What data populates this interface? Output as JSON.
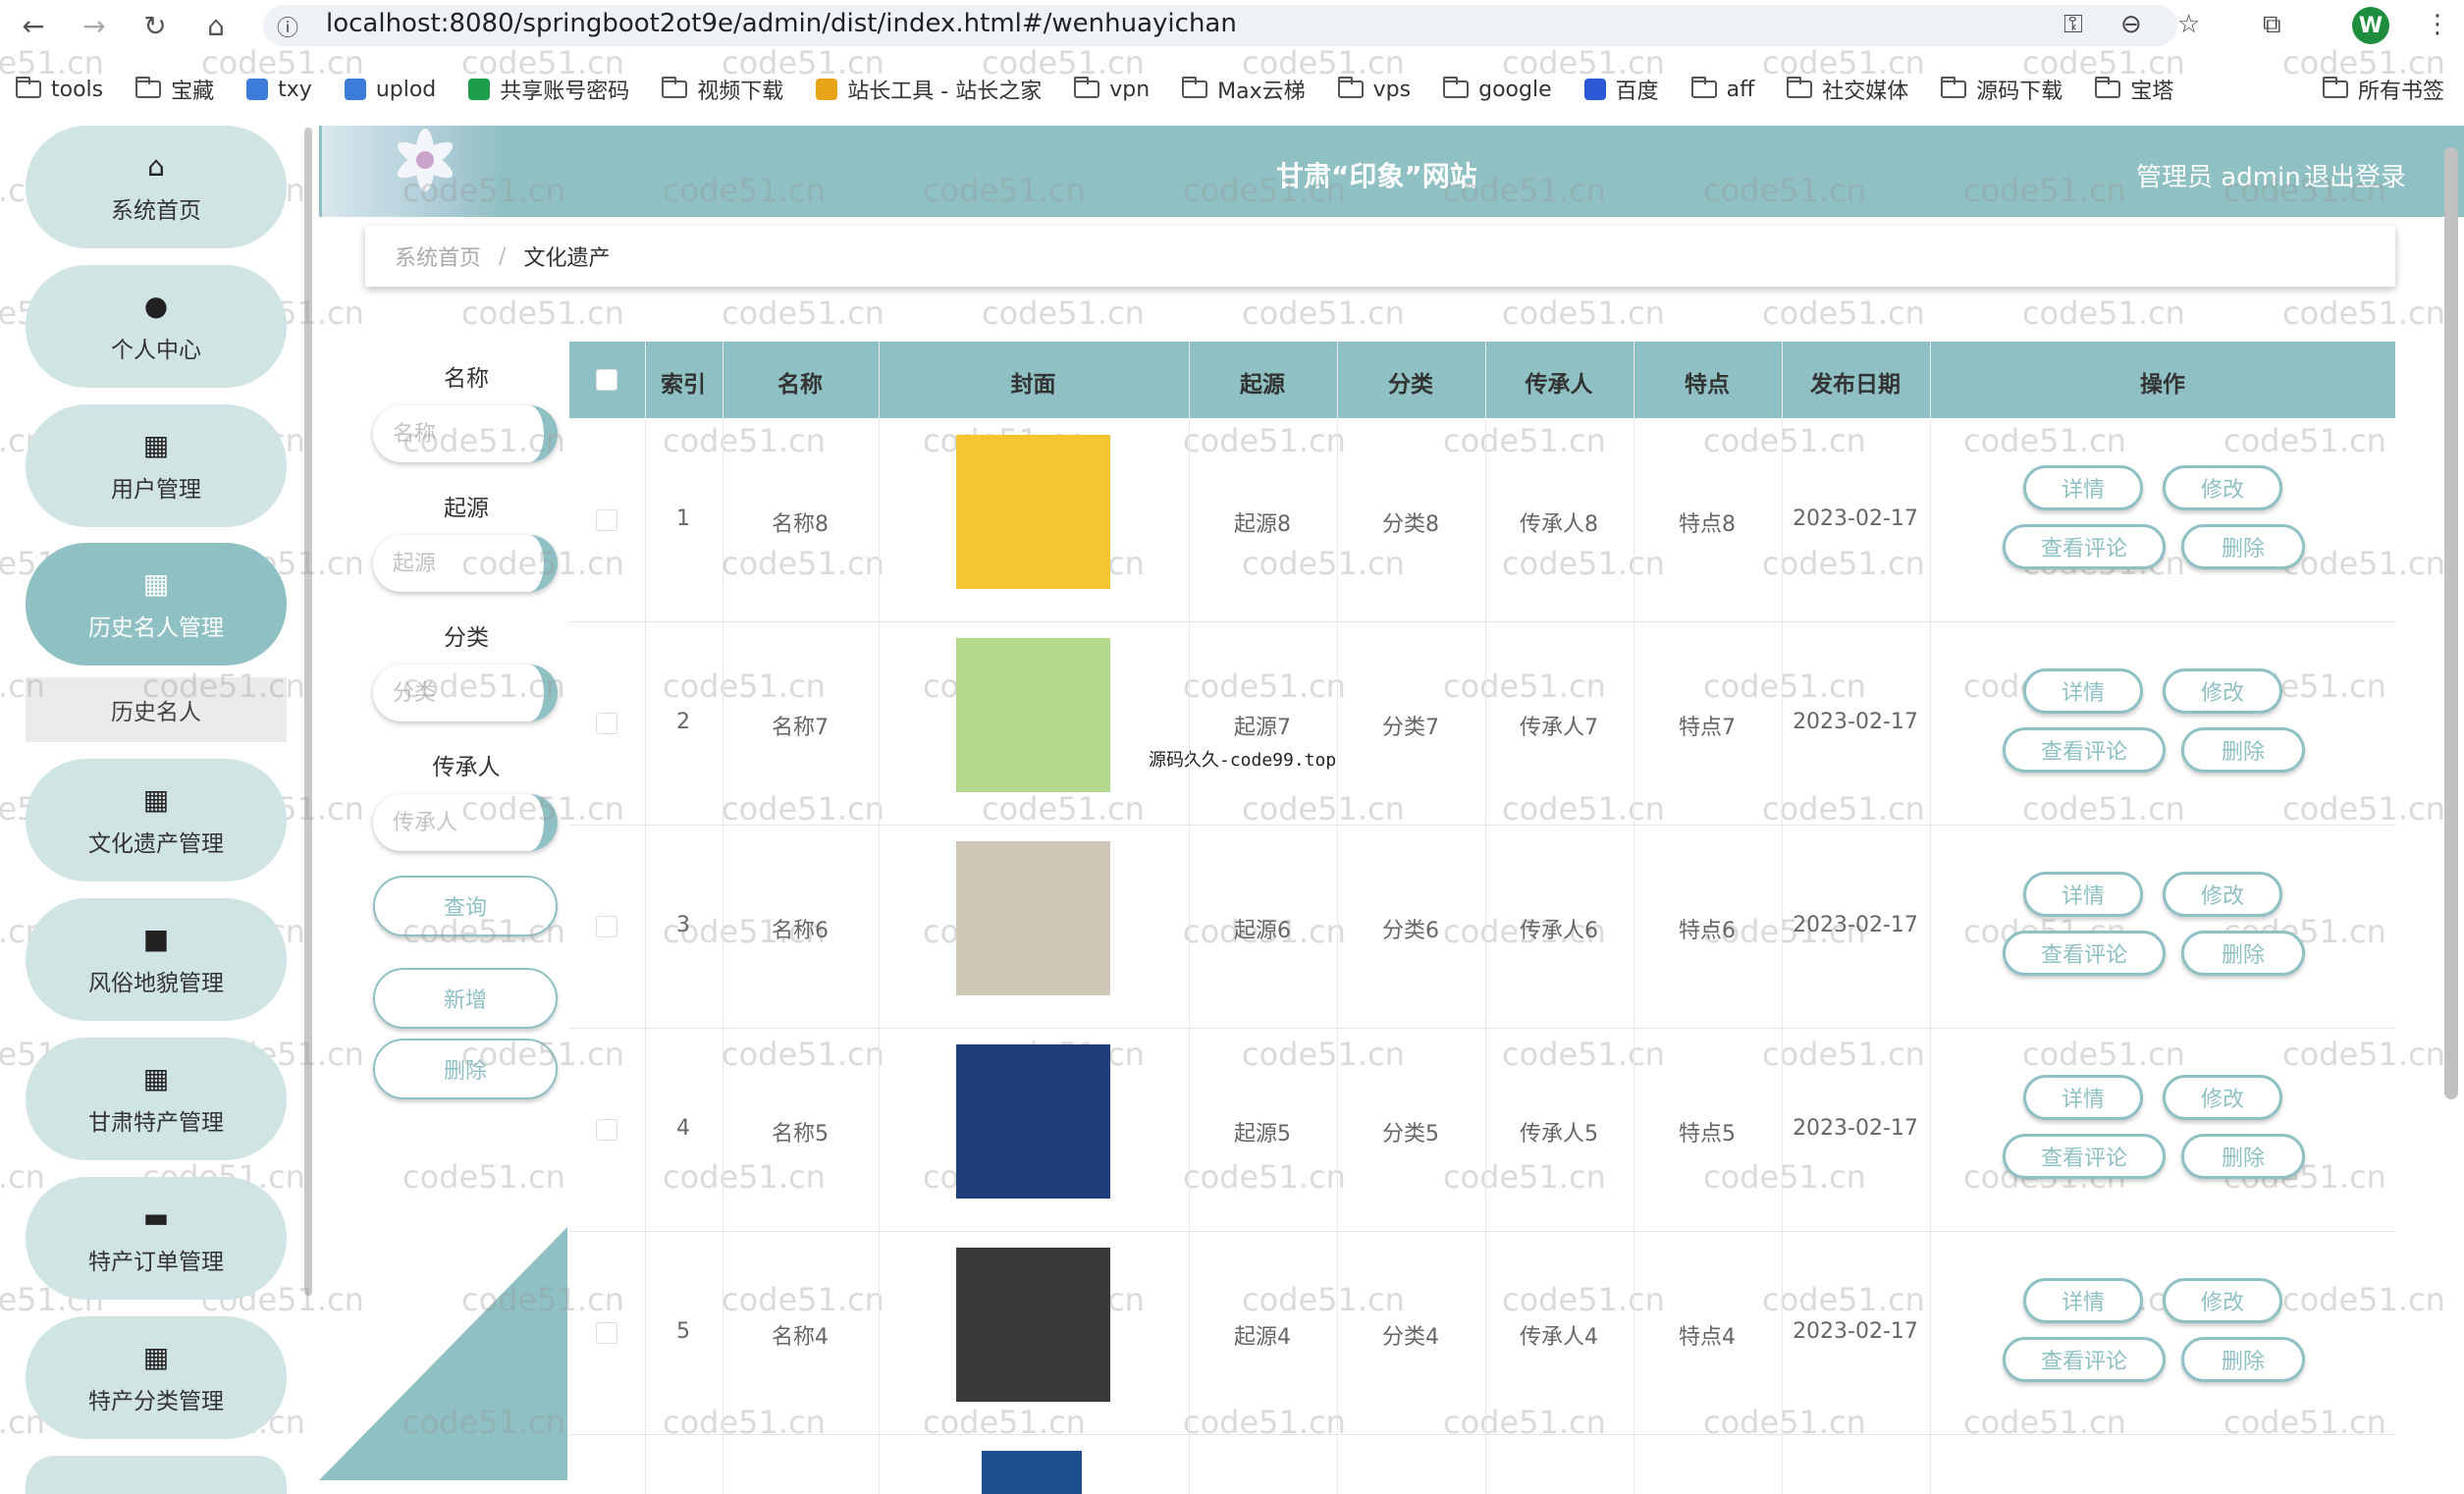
{
  "browser": {
    "url": "localhost:8080/springboot2ot9e/admin/dist/index.html#/wenhuayichan",
    "avatar": "W"
  },
  "bookmarks": [
    {
      "label": "tools",
      "icon": "folder-icon"
    },
    {
      "label": "宝藏",
      "icon": "folder-icon"
    },
    {
      "label": "txy",
      "icon": "cloud-icon"
    },
    {
      "label": "uplod",
      "icon": "cloud-icon"
    },
    {
      "label": "共享账号密码",
      "icon": "sheet-icon"
    },
    {
      "label": "视频下载",
      "icon": "folder-icon"
    },
    {
      "label": "站长工具 - 站长之家",
      "icon": "site-icon"
    },
    {
      "label": "vpn",
      "icon": "folder-icon"
    },
    {
      "label": "Max云梯",
      "icon": "folder-icon"
    },
    {
      "label": "vps",
      "icon": "folder-icon"
    },
    {
      "label": "google",
      "icon": "folder-icon"
    },
    {
      "label": "百度",
      "icon": "paw-icon"
    },
    {
      "label": "aff",
      "icon": "folder-icon"
    },
    {
      "label": "社交媒体",
      "icon": "folder-icon"
    },
    {
      "label": "源码下载",
      "icon": "folder-icon"
    },
    {
      "label": "宝塔",
      "icon": "folder-icon"
    }
  ],
  "bookmarks_all": "所有书签",
  "sidebar": {
    "items": [
      {
        "label": "系统首页",
        "icon": "home-icon",
        "glyph": "⌂"
      },
      {
        "label": "个人中心",
        "icon": "person-icon",
        "glyph": "●"
      },
      {
        "label": "用户管理",
        "icon": "grid-icon",
        "glyph": "▦"
      },
      {
        "label": "历史名人管理",
        "icon": "grid-icon",
        "glyph": "▦"
      },
      {
        "label": "文化遗产管理",
        "icon": "grid-icon",
        "glyph": "▦"
      },
      {
        "label": "风俗地貌管理",
        "icon": "video-icon",
        "glyph": "■"
      },
      {
        "label": "甘肃特产管理",
        "icon": "grid-icon",
        "glyph": "▦"
      },
      {
        "label": "特产订单管理",
        "icon": "briefcase-icon",
        "glyph": "▬"
      },
      {
        "label": "特产分类管理",
        "icon": "grid-icon",
        "glyph": "▦"
      }
    ],
    "sub_item": "历史名人"
  },
  "header": {
    "title": "甘肃“印象”网站",
    "user": "管理员 admin",
    "logout": "退出登录"
  },
  "breadcrumb": {
    "home": "系统首页",
    "sep": "/",
    "current": "文化遗产"
  },
  "filters": {
    "name_label": "名称",
    "name_placeholder": "名称",
    "origin_label": "起源",
    "origin_placeholder": "起源",
    "category_label": "分类",
    "category_placeholder": "分类",
    "inheritor_label": "传承人",
    "inheritor_placeholder": "传承人",
    "query": "查询",
    "add": "新增",
    "delete": "删除"
  },
  "table": {
    "headers": {
      "index": "索引",
      "name": "名称",
      "cover": "封面",
      "origin": "起源",
      "category": "分类",
      "inheritor": "传承人",
      "feature": "特点",
      "date": "发布日期",
      "action": "操作"
    },
    "rows": [
      {
        "index": "1",
        "name": "名称8",
        "origin": "起源8",
        "category": "分类8",
        "inheritor": "传承人8",
        "feature": "特点8",
        "date": "2023-02-17",
        "cover_color": "#f2c531"
      },
      {
        "index": "2",
        "name": "名称7",
        "origin": "起源7",
        "category": "分类7",
        "inheritor": "传承人7",
        "feature": "特点7",
        "date": "2023-02-17",
        "cover_color": "#b5d98c"
      },
      {
        "index": "3",
        "name": "名称6",
        "origin": "起源6",
        "category": "分类6",
        "inheritor": "传承人6",
        "feature": "特点6",
        "date": "2023-02-17",
        "cover_color": "#cfc7b8"
      },
      {
        "index": "4",
        "name": "名称5",
        "origin": "起源5",
        "category": "分类5",
        "inheritor": "传承人5",
        "feature": "特点5",
        "date": "2023-02-17",
        "cover_color": "#1f3f7a"
      },
      {
        "index": "5",
        "name": "名称4",
        "origin": "起源4",
        "category": "分类4",
        "inheritor": "传承人4",
        "feature": "特点4",
        "date": "2023-02-17",
        "cover_color": "#3a3a3a"
      }
    ],
    "actions": {
      "detail": "详情",
      "edit": "修改",
      "comments": "查看评论",
      "delete": "删除"
    }
  },
  "overlay_text": "源码久久-code99.top",
  "watermark": "code51.cn",
  "colors": {
    "accent": "#8fc0c3",
    "sidebar_bg": "#d1e4e4"
  }
}
